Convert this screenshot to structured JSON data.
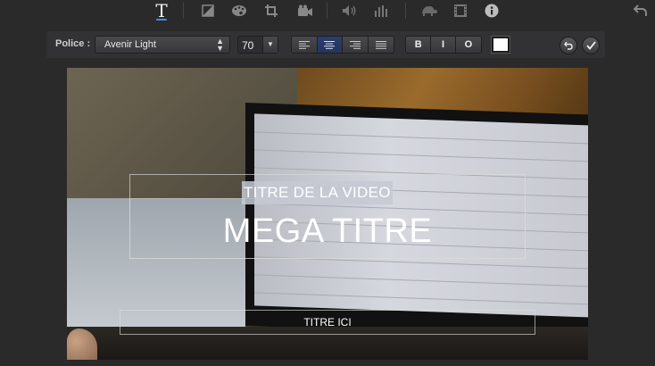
{
  "toolbar": {
    "tools": [
      {
        "name": "text-tool",
        "icon": "text-T-icon"
      },
      {
        "name": "color-balance-tool",
        "icon": "color-balance-icon"
      },
      {
        "name": "color-correction-tool",
        "icon": "palette-icon"
      },
      {
        "name": "crop-tool",
        "icon": "crop-icon"
      },
      {
        "name": "stabilization-tool",
        "icon": "video-camera-icon"
      },
      {
        "name": "volume-tool",
        "icon": "speaker-icon"
      },
      {
        "name": "noise-reduction-tool",
        "icon": "equalizer-icon"
      },
      {
        "name": "speed-tool",
        "icon": "turtle-icon"
      },
      {
        "name": "clip-filter-tool",
        "icon": "film-strip-icon"
      },
      {
        "name": "info-tool",
        "icon": "info-icon"
      }
    ],
    "undo_icon": "undo-arrow-icon"
  },
  "format": {
    "font_label": "Police :",
    "font_value": "Avenir Light",
    "size_value": "70",
    "align_buttons": [
      "align-left",
      "align-center",
      "align-right",
      "justify"
    ],
    "align_selected": "align-center",
    "style_buttons": [
      "B",
      "I",
      "O"
    ],
    "color": "#ffffff",
    "revert_icon": "revert-icon",
    "apply_icon": "checkmark-icon"
  },
  "viewer": {
    "title_top": "TITRE DE LA VIDEO",
    "title_main": "MEGA TITRE",
    "title_lower": "TITRE ICI"
  },
  "colors": {
    "background": "#2a2a2b",
    "accent": "#3d8ee6",
    "selected_align": "#2c3f6e"
  }
}
